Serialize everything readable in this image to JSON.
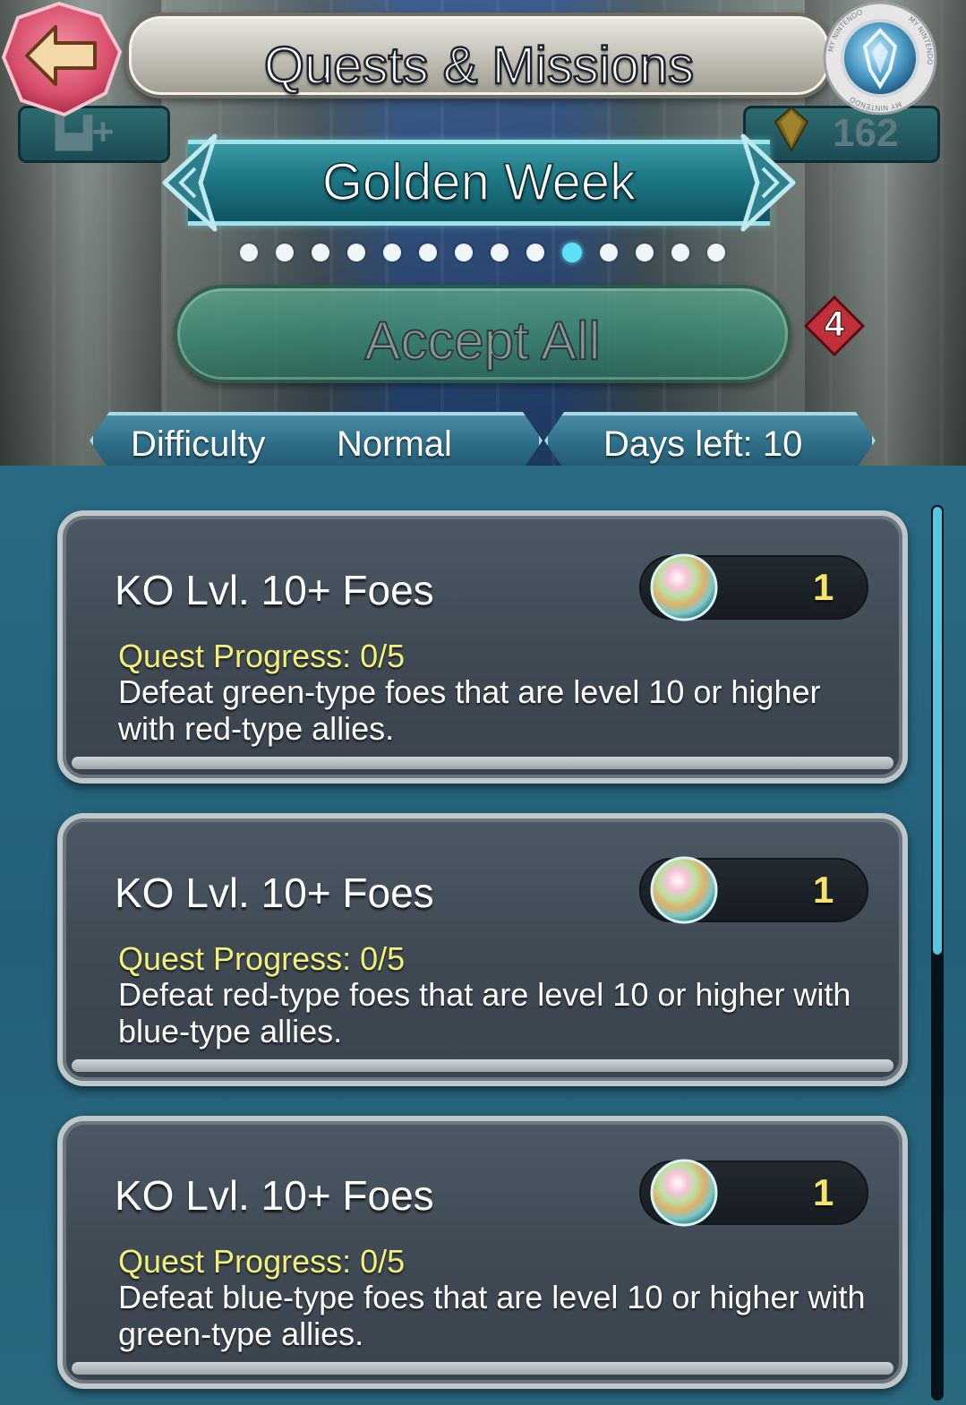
{
  "header": {
    "title": "Quests & Missions",
    "back_icon": "back-arrow-icon",
    "nintendo_icon": "my-nintendo-icon",
    "nintendo_ring_text": "MY NINTENDO"
  },
  "top_status": {
    "castle_label": "+",
    "orb_count": "162"
  },
  "week": {
    "title": "Golden Week",
    "pages_total": 14,
    "active_page_index": 9
  },
  "accept": {
    "label": "Accept All",
    "badge_count": "4"
  },
  "info": {
    "difficulty_label": "Difficulty",
    "difficulty_value": "Normal",
    "days_left": "Days left: 10"
  },
  "quests": [
    {
      "title": "KO Lvl. 10+ Foes",
      "reward_icon": "orb-icon",
      "reward_count": "1",
      "progress": "Quest Progress: 0/5",
      "description": "Defeat green-type foes that are level 10 or higher with red-type allies."
    },
    {
      "title": "KO Lvl. 10+ Foes",
      "reward_icon": "orb-icon",
      "reward_count": "1",
      "progress": "Quest Progress: 0/5",
      "description": "Defeat red-type foes that are level 10 or higher with blue-type allies."
    },
    {
      "title": "KO Lvl. 10+ Foes",
      "reward_icon": "orb-icon",
      "reward_count": "1",
      "progress": "Quest Progress: 0/5",
      "description": "Defeat blue-type foes that are level 10 or higher with green-type allies."
    }
  ],
  "colors": {
    "accent_teal": "#5ee0f7",
    "progress_yellow": "#f2f07a",
    "reward_yellow": "#f4e56a",
    "badge_red": "#c0303a"
  }
}
